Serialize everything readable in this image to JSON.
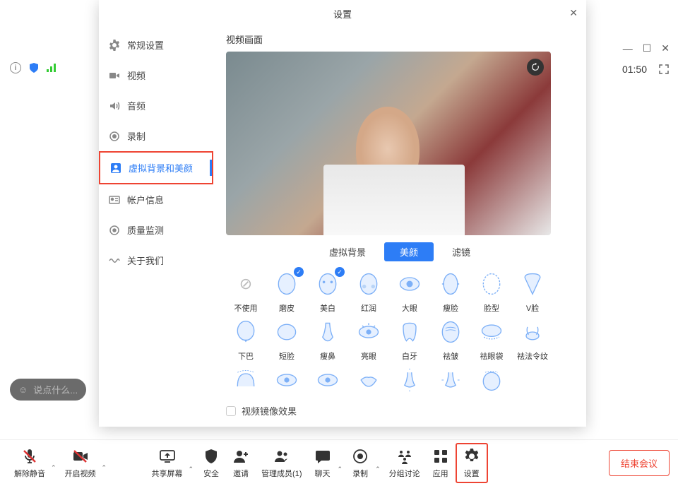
{
  "bg": {
    "timer": "01:50",
    "chat_placeholder": "说点什么..."
  },
  "modal": {
    "title": "设置",
    "section_label": "视频画面",
    "sidebar": [
      {
        "label": "常规设置",
        "icon": "gear"
      },
      {
        "label": "视频",
        "icon": "video"
      },
      {
        "label": "音频",
        "icon": "audio"
      },
      {
        "label": "录制",
        "icon": "record"
      },
      {
        "label": "虚拟背景和美颜",
        "icon": "person",
        "active": true,
        "highlighted": true
      },
      {
        "label": "帐户信息",
        "icon": "id"
      },
      {
        "label": "质量监测",
        "icon": "target"
      },
      {
        "label": "关于我们",
        "icon": "wave"
      }
    ],
    "tabs": [
      {
        "label": "虚拟背景"
      },
      {
        "label": "美颜",
        "active": true
      },
      {
        "label": "滤镜"
      }
    ],
    "effects_row1": [
      {
        "label": "不使用",
        "type": "none"
      },
      {
        "label": "磨皮",
        "type": "face",
        "badge": true
      },
      {
        "label": "美白",
        "type": "mask",
        "badge": true
      },
      {
        "label": "红润",
        "type": "face"
      },
      {
        "label": "大眼",
        "type": "eye"
      },
      {
        "label": "瘦脸",
        "type": "slim"
      },
      {
        "label": "脸型",
        "type": "shape"
      },
      {
        "label": "V脸",
        "type": "vface"
      }
    ],
    "effects_row2": [
      {
        "label": "下巴",
        "type": "chin"
      },
      {
        "label": "短脸",
        "type": "short"
      },
      {
        "label": "瘦鼻",
        "type": "nose"
      },
      {
        "label": "亮眼",
        "type": "bright"
      },
      {
        "label": "白牙",
        "type": "teeth"
      },
      {
        "label": "祛皱",
        "type": "wrinkle"
      },
      {
        "label": "祛眼袋",
        "type": "eyebag"
      },
      {
        "label": "祛法令纹",
        "type": "lines"
      }
    ],
    "effects_row3": [
      {
        "label": "",
        "type": "forehead"
      },
      {
        "label": "",
        "type": "eye2"
      },
      {
        "label": "",
        "type": "eye3"
      },
      {
        "label": "",
        "type": "mouth"
      },
      {
        "label": "",
        "type": "nose2"
      },
      {
        "label": "",
        "type": "nose3"
      },
      {
        "label": "",
        "type": "face2"
      }
    ],
    "mirror_label": "视频镜像效果"
  },
  "toolbar": {
    "unmute": "解除静音",
    "start_video": "开启视频",
    "share_screen": "共享屏幕",
    "security": "安全",
    "invite": "邀请",
    "manage_members": "管理成员(1)",
    "chat": "聊天",
    "record": "录制",
    "breakout": "分组讨论",
    "apps": "应用",
    "settings": "设置",
    "end_meeting": "结束会议"
  }
}
